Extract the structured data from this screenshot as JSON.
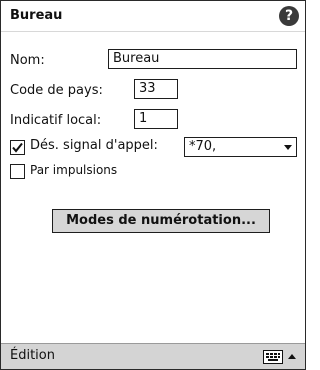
{
  "window": {
    "title": "Bureau",
    "help_icon": "?"
  },
  "form": {
    "name_label": "Nom:",
    "name_value": "Bureau",
    "country_code_label": "Code de pays:",
    "country_code_value": "33",
    "area_code_label": "Indicatif local:",
    "area_code_value": "1",
    "disable_call_waiting_label": "Dés. signal d'appel:",
    "disable_call_waiting_checked": true,
    "disable_call_waiting_value": "*70,",
    "pulse_label": "Par impulsions",
    "pulse_checked": false
  },
  "buttons": {
    "dialing_patterns": "Modes de numérotation..."
  },
  "menubar": {
    "edit_label": "Édition"
  }
}
